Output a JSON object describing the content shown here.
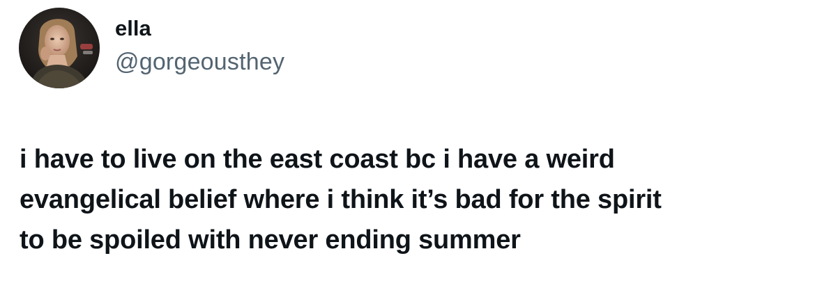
{
  "tweet": {
    "author": {
      "display_name": "ella",
      "handle": "@gorgeousthey",
      "avatar_icon": "profile-photo"
    },
    "text_lines": [
      "i have to live on the east coast bc i have a weird",
      "evangelical belief where i think it’s bad for the spirit",
      "to be spoiled with never ending summer"
    ]
  },
  "colors": {
    "text_primary": "#0f1419",
    "text_secondary": "#536471",
    "background": "#ffffff"
  }
}
